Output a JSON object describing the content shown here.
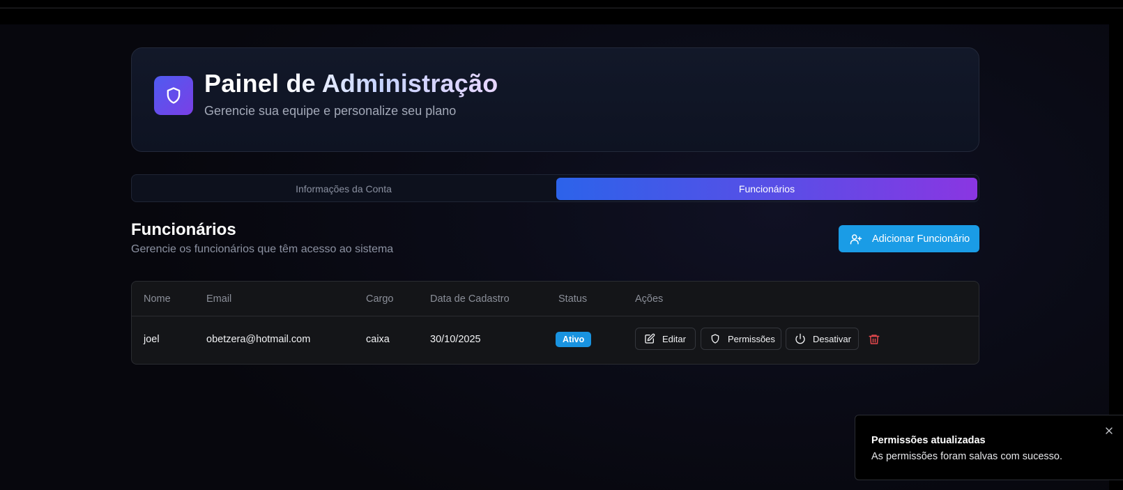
{
  "header": {
    "title": "Painel de Administração",
    "subtitle": "Gerencie sua equipe e personalize seu plano",
    "logo_icon": "shield-icon"
  },
  "tabs": [
    {
      "label": "Informações da Conta",
      "active": false
    },
    {
      "label": "Funcionários",
      "active": true
    }
  ],
  "section": {
    "title": "Funcionários",
    "subtitle": "Gerencie os funcionários que têm acesso ao sistema",
    "add_button_label": "Adicionar Funcionário",
    "add_button_icon": "user-plus-icon"
  },
  "table": {
    "columns": [
      "Nome",
      "Email",
      "Cargo",
      "Data de Cadastro",
      "Status",
      "Ações"
    ],
    "rows": [
      {
        "name": "joel",
        "email": "obetzera@hotmail.com",
        "role": "caixa",
        "created": "30/10/2025",
        "status": "Ativo",
        "actions": {
          "edit": "Editar",
          "permissions": "Permissões",
          "deactivate": "Desativar"
        }
      }
    ]
  },
  "toast": {
    "title": "Permissões atualizadas",
    "description": "As permissões foram salvas com sucesso."
  },
  "colors": {
    "accent_blue": "#1a9ce6",
    "status_active": "#1993e0",
    "danger": "#e5484d",
    "tab_gradient_start": "#2c63ea",
    "tab_gradient_end": "#8a36e2"
  }
}
